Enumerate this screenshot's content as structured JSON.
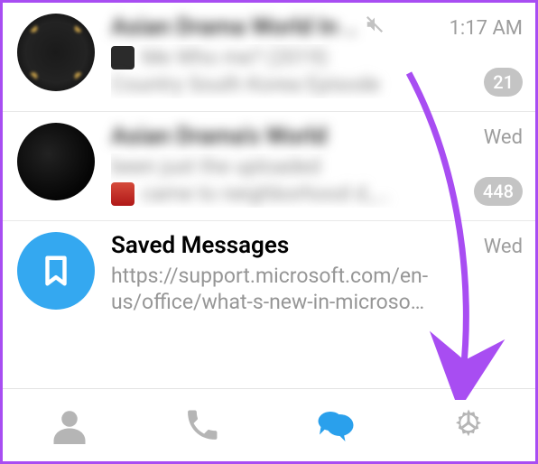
{
  "chats": [
    {
      "title": "Asian Drama World In ..",
      "time": "1:17 AM",
      "muted": true,
      "preview1": "Me   Who me? (2019)",
      "preview2": "Country  South Korea  Episode",
      "badge": "21"
    },
    {
      "title": "Asian Drama's World",
      "time": "Wed",
      "muted": false,
      "preview1": "been just the uploaded",
      "preview2": "came to neighborhood d_…",
      "badge": "448"
    },
    {
      "title": "Saved Messages",
      "time": "Wed",
      "muted": false,
      "preview": "https://support.microsoft.com/en-us/office/what-s-new-in-microso…",
      "badge": null
    }
  ],
  "tabs": {
    "contacts": "contacts",
    "calls": "calls",
    "chats": "chats",
    "settings": "settings"
  }
}
